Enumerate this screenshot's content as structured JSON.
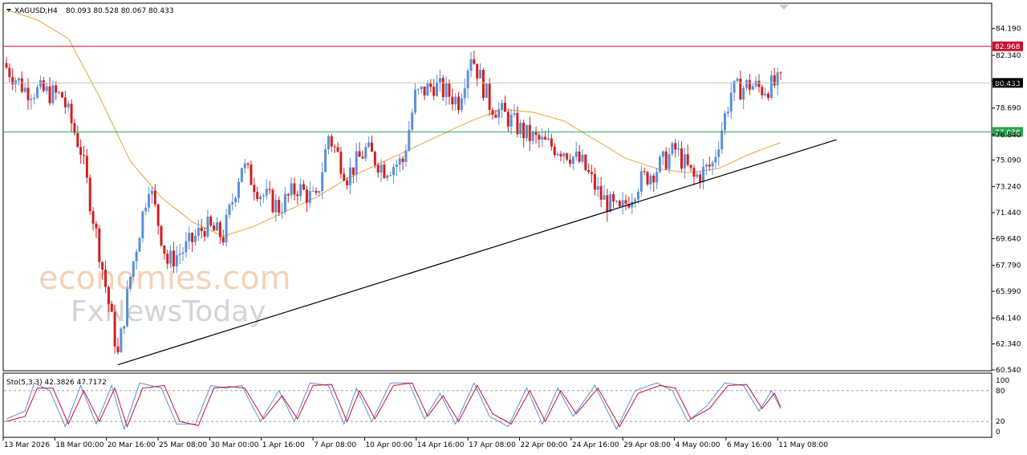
{
  "header": {
    "symbol": "XAGUSD,H4",
    "ohlc": "80.093 80.528 80.067 80.433"
  },
  "stochastic": {
    "label": "Sto(5,3,3) 42.3826 47.7172",
    "levels": [
      "100",
      "80",
      "20",
      "0"
    ]
  },
  "watermark": {
    "line1": "economies.com",
    "line2": "FxNewsToday"
  },
  "colors": {
    "bull": "#5b8fd9",
    "bear": "#d21f1f",
    "ma": "#e8a23a",
    "resistance": "#c8102e",
    "support": "#2aa44f",
    "current": "#000000",
    "stoch_main": "#5b8fd9",
    "stoch_signal": "#c8102e"
  },
  "chart_data": {
    "type": "candlestick",
    "symbol": "XAGUSD",
    "timeframe": "H4",
    "ylim": [
      60.54,
      85.9
    ],
    "y_ticks": [
      "84.190",
      "82.340",
      "80.540",
      "78.690",
      "76.840",
      "75.090",
      "73.240",
      "71.440",
      "69.640",
      "67.790",
      "65.990",
      "64.140",
      "62.340",
      "60.540"
    ],
    "x_tick_labels": [
      "13 Mar 2026",
      "18 Mar 00:00",
      "20 Mar 16:00",
      "25 Mar 08:00",
      "30 Mar 00:00",
      "1 Apr 16:00",
      "7 Apr 08:00",
      "10 Apr 00:00",
      "14 Apr 16:00",
      "17 Apr 08:00",
      "22 Apr 00:00",
      "24 Apr 16:00",
      "29 Apr 08:00",
      "4 May 00:00",
      "6 May 16:00",
      "11 May 08:00"
    ],
    "price_levels": [
      {
        "label": "82.968",
        "value": 82.968,
        "kind": "resistance"
      },
      {
        "label": "80.433",
        "value": 80.433,
        "kind": "current"
      },
      {
        "label": "77.038",
        "value": 77.038,
        "kind": "support"
      }
    ],
    "trendline": {
      "from_bar": 36,
      "from_price": 60.9,
      "to_bar": 268,
      "to_price": 76.5
    },
    "close_path": [
      [
        0,
        81.5
      ],
      [
        6,
        80.0
      ],
      [
        12,
        79.8
      ],
      [
        18,
        79.5
      ],
      [
        24,
        75.8
      ],
      [
        30,
        68.8
      ],
      [
        36,
        61.5
      ],
      [
        40,
        67.0
      ],
      [
        46,
        73.5
      ],
      [
        52,
        68.0
      ],
      [
        58,
        69.0
      ],
      [
        64,
        70.5
      ],
      [
        70,
        69.8
      ],
      [
        76,
        74.8
      ],
      [
        82,
        72.8
      ],
      [
        88,
        71.8
      ],
      [
        94,
        73.2
      ],
      [
        100,
        72.2
      ],
      [
        104,
        76.8
      ],
      [
        110,
        74.0
      ],
      [
        116,
        75.8
      ],
      [
        122,
        74.5
      ],
      [
        128,
        75.0
      ],
      [
        132,
        79.5
      ],
      [
        138,
        80.3
      ],
      [
        146,
        79.2
      ],
      [
        150,
        82.5
      ],
      [
        156,
        79.0
      ],
      [
        162,
        78.0
      ],
      [
        168,
        76.8
      ],
      [
        174,
        76.2
      ],
      [
        180,
        75.8
      ],
      [
        186,
        74.8
      ],
      [
        192,
        72.5
      ],
      [
        198,
        71.4
      ],
      [
        204,
        73.5
      ],
      [
        210,
        74.5
      ],
      [
        216,
        75.8
      ],
      [
        222,
        73.8
      ],
      [
        228,
        74.8
      ],
      [
        234,
        79.8
      ],
      [
        240,
        80.3
      ],
      [
        244,
        80.0
      ],
      [
        250,
        80.45
      ]
    ],
    "ma_path": [
      [
        0,
        85.5
      ],
      [
        10,
        84.8
      ],
      [
        20,
        83.5
      ],
      [
        30,
        79.5
      ],
      [
        40,
        75.0
      ],
      [
        50,
        72.5
      ],
      [
        60,
        70.8
      ],
      [
        70,
        69.8
      ],
      [
        80,
        70.5
      ],
      [
        90,
        71.5
      ],
      [
        100,
        72.5
      ],
      [
        110,
        73.8
      ],
      [
        120,
        74.8
      ],
      [
        130,
        75.8
      ],
      [
        140,
        76.8
      ],
      [
        150,
        77.8
      ],
      [
        160,
        78.6
      ],
      [
        170,
        78.4
      ],
      [
        180,
        77.8
      ],
      [
        190,
        76.5
      ],
      [
        200,
        75.2
      ],
      [
        210,
        74.5
      ],
      [
        220,
        74.2
      ],
      [
        230,
        74.5
      ],
      [
        240,
        75.5
      ],
      [
        250,
        76.3
      ]
    ],
    "stoch_main_path": [
      [
        0,
        25
      ],
      [
        6,
        40
      ],
      [
        9,
        95
      ],
      [
        14,
        80
      ],
      [
        19,
        10
      ],
      [
        24,
        90
      ],
      [
        29,
        15
      ],
      [
        34,
        90
      ],
      [
        38,
        5
      ],
      [
        43,
        95
      ],
      [
        50,
        85
      ],
      [
        55,
        15
      ],
      [
        61,
        15
      ],
      [
        66,
        90
      ],
      [
        71,
        85
      ],
      [
        76,
        90
      ],
      [
        82,
        20
      ],
      [
        88,
        80
      ],
      [
        93,
        20
      ],
      [
        98,
        95
      ],
      [
        104,
        90
      ],
      [
        109,
        15
      ],
      [
        113,
        85
      ],
      [
        118,
        20
      ],
      [
        124,
        95
      ],
      [
        130,
        95
      ],
      [
        135,
        25
      ],
      [
        140,
        75
      ],
      [
        145,
        15
      ],
      [
        151,
        95
      ],
      [
        156,
        30
      ],
      [
        162,
        10
      ],
      [
        168,
        85
      ],
      [
        173,
        15
      ],
      [
        178,
        85
      ],
      [
        183,
        30
      ],
      [
        190,
        90
      ],
      [
        197,
        5
      ],
      [
        203,
        80
      ],
      [
        210,
        95
      ],
      [
        215,
        80
      ],
      [
        220,
        20
      ],
      [
        226,
        50
      ],
      [
        232,
        95
      ],
      [
        238,
        90
      ],
      [
        243,
        40
      ],
      [
        247,
        80
      ],
      [
        250,
        45
      ]
    ],
    "stoch_signal_path": [
      [
        0,
        20
      ],
      [
        6,
        30
      ],
      [
        10,
        85
      ],
      [
        15,
        85
      ],
      [
        20,
        15
      ],
      [
        25,
        80
      ],
      [
        30,
        20
      ],
      [
        35,
        85
      ],
      [
        39,
        10
      ],
      [
        44,
        85
      ],
      [
        51,
        90
      ],
      [
        56,
        20
      ],
      [
        62,
        12
      ],
      [
        67,
        85
      ],
      [
        72,
        88
      ],
      [
        77,
        85
      ],
      [
        83,
        25
      ],
      [
        89,
        70
      ],
      [
        94,
        25
      ],
      [
        99,
        90
      ],
      [
        105,
        92
      ],
      [
        110,
        20
      ],
      [
        114,
        80
      ],
      [
        119,
        25
      ],
      [
        125,
        90
      ],
      [
        131,
        95
      ],
      [
        136,
        30
      ],
      [
        141,
        70
      ],
      [
        146,
        20
      ],
      [
        152,
        90
      ],
      [
        157,
        35
      ],
      [
        163,
        15
      ],
      [
        169,
        80
      ],
      [
        174,
        20
      ],
      [
        179,
        80
      ],
      [
        184,
        35
      ],
      [
        191,
        85
      ],
      [
        198,
        10
      ],
      [
        204,
        75
      ],
      [
        211,
        90
      ],
      [
        216,
        85
      ],
      [
        221,
        25
      ],
      [
        227,
        45
      ],
      [
        233,
        90
      ],
      [
        239,
        92
      ],
      [
        244,
        45
      ],
      [
        248,
        75
      ],
      [
        250,
        48
      ]
    ]
  }
}
